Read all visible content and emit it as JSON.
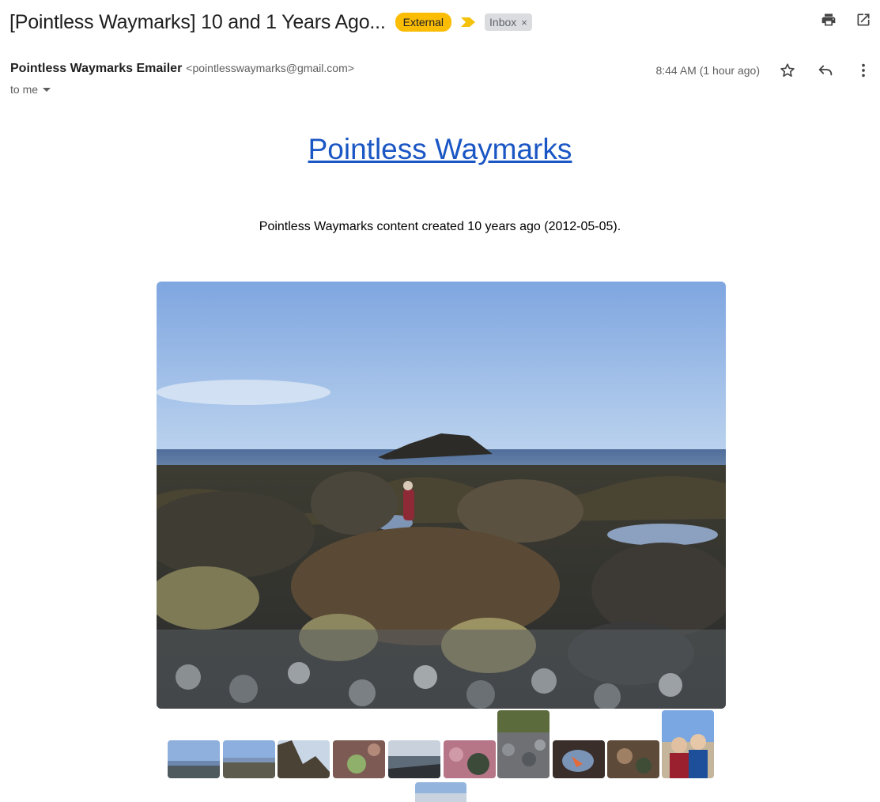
{
  "email": {
    "subject": "[Pointless Waymarks] 10 and 1 Years Ago...",
    "labels": {
      "external": "External",
      "inbox": "Inbox"
    },
    "sender_name": "Pointless Waymarks Emailer",
    "sender_email": "<pointlesswaymarks@gmail.com>",
    "timestamp": "8:44 AM (1 hour ago)",
    "recipient": "to me"
  },
  "content": {
    "site_link": "Pointless Waymarks",
    "intro": "Pointless Waymarks content created 10 years ago (2012-05-05)."
  },
  "icons": {
    "print": "print-icon",
    "open_new": "open-in-new-window-icon",
    "star": "star-icon",
    "reply": "reply-icon",
    "more": "more-vertical-icon",
    "importance": "importance-marker-icon",
    "remove_label": "close-icon",
    "expand_details": "caret-down-icon"
  },
  "colors": {
    "external_chip": "#fbbc04",
    "inbox_chip": "#dadce0",
    "link": "#1a56c4"
  }
}
